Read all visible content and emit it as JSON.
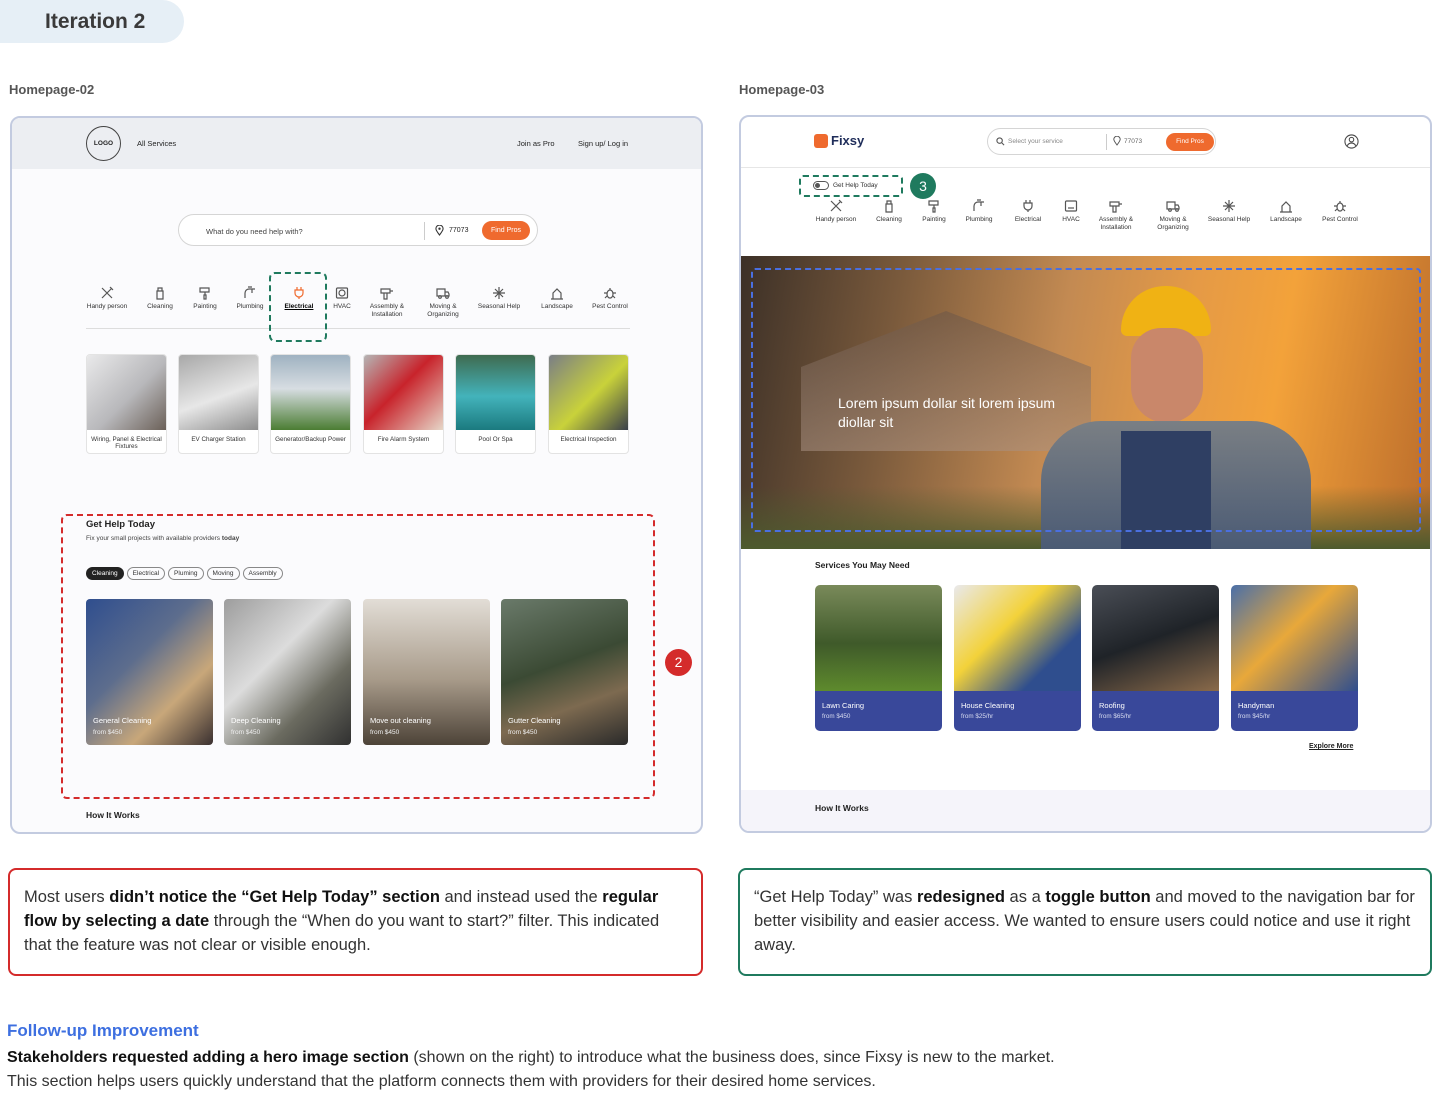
{
  "header": {
    "iteration": "Iteration 2"
  },
  "left": {
    "caption": "Homepage-02",
    "nav": {
      "logo": "LOGO",
      "all_services": "All Services",
      "join": "Join as Pro",
      "signup": "Sign up/ Log in"
    },
    "search": {
      "placeholder": "What do you need help with?",
      "zip": "77073",
      "button": "Find Pros"
    },
    "categories": [
      "Handy person",
      "Cleaning",
      "Painting",
      "Plumbing",
      "Electrical",
      "HVAC",
      "Assembly & Installation",
      "Moving & Organizing",
      "Seasonal Help",
      "Landscape",
      "Pest Control"
    ],
    "services": [
      "Wiring, Panel & Electrical Fixtures",
      "EV Charger Station",
      "Generator/Backup Power",
      "Fire Alarm System",
      "Pool Or Spa",
      "Electrical Inspection"
    ],
    "get_help": {
      "title": "Get Help Today",
      "subtitle": "Fix your small projects with available providers",
      "subtitle_bold": "today",
      "chips": [
        "Cleaning",
        "Electrical",
        "Pluming",
        "Moving",
        "Assembly"
      ],
      "cards": [
        {
          "title": "General Cleaning",
          "price": "from $450"
        },
        {
          "title": "Deep Cleaning",
          "price": "from $450"
        },
        {
          "title": "Move out cleaning",
          "price": "from $450"
        },
        {
          "title": "Gutter Cleaning",
          "price": "from $450"
        }
      ]
    },
    "badge": "2",
    "how_it_works": "How It Works"
  },
  "right": {
    "caption": "Homepage-03",
    "brand": "Fixsy",
    "search": {
      "placeholder": "Select your service",
      "zip": "77073",
      "button": "Find Pros"
    },
    "toggle_label": "Get Help Today",
    "badge": "3",
    "categories": [
      "Handy person",
      "Cleaning",
      "Painting",
      "Plumbing",
      "Electrical",
      "HVAC",
      "Assembly & Installation",
      "Moving & Organizing",
      "Seasonal Help",
      "Landscape",
      "Pest Control"
    ],
    "hero_text": "Lorem ipsum dollar sit lorem ipsum diollar sit",
    "services_title": "Services You May Need",
    "services": [
      {
        "title": "Lawn Caring",
        "price": "from $450"
      },
      {
        "title": "House Cleaning",
        "price": "from $25/hr"
      },
      {
        "title": "Roofing",
        "price": "from $65/hr"
      },
      {
        "title": "Handyman",
        "price": "from $45/hr"
      }
    ],
    "explore_more": "Explore More",
    "how_it_works": "How It Works"
  },
  "notes": {
    "left": {
      "p1": "Most users ",
      "b1": "didn’t notice the “Get Help Today” section",
      "p2": " and instead used the ",
      "b2": "regular flow by selecting a date",
      "p3": " through the “When do you want to start?” filter. This indicated that the feature was not clear or visible enough."
    },
    "right": {
      "p1": "“Get Help Today” was ",
      "b1": "redesigned",
      "p2": " as a ",
      "b2": "toggle button",
      "p3": " and moved to the navigation bar for better visibility and easier access. We wanted to ensure users could notice and use it right away."
    }
  },
  "followup": {
    "title": "Follow-up Improvement",
    "bold": "Stakeholders requested adding a hero image section",
    "text": " (shown on the right) to introduce what the business does, since Fixsy is new to the market. This section helps users quickly understand that the platform connects them with providers for their desired home services."
  },
  "colors": {
    "accent_orange": "#ef6a2e",
    "red_dash": "#d42b2b",
    "green_dash": "#1f7a5e",
    "blue_dash": "#4a6fe0",
    "navy_card": "#39489a",
    "link_blue": "#3d6fe0"
  }
}
